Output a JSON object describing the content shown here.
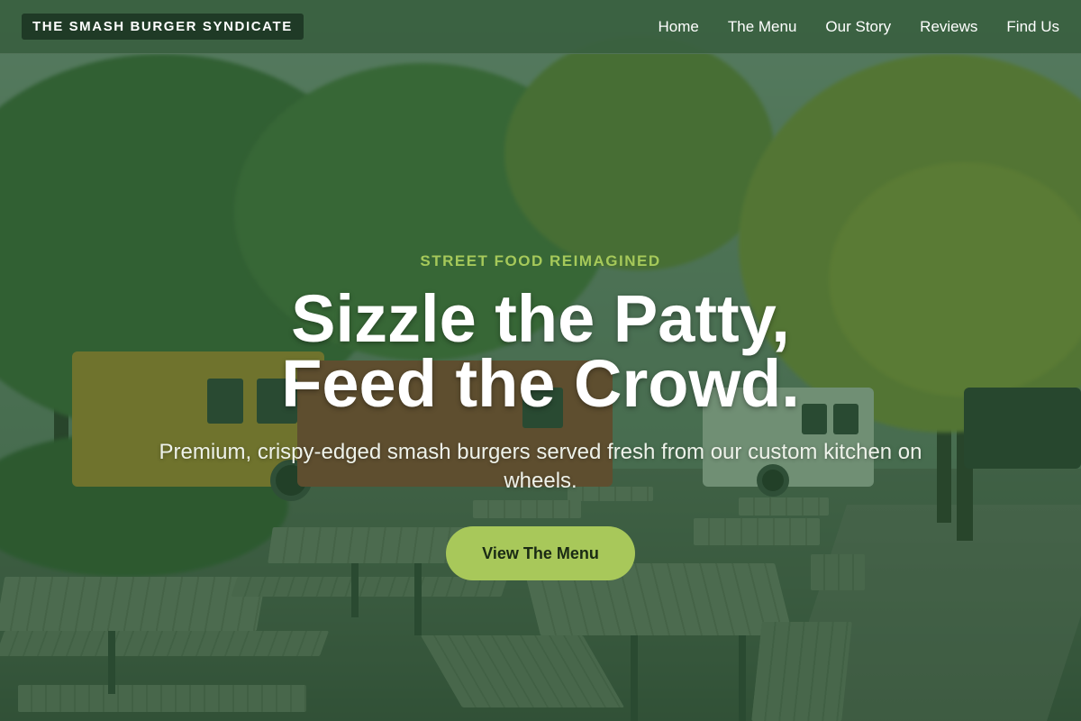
{
  "header": {
    "brand": "THE SMASH BURGER SYNDICATE",
    "nav": [
      {
        "label": "Home"
      },
      {
        "label": "The Menu"
      },
      {
        "label": "Our Story"
      },
      {
        "label": "Reviews"
      },
      {
        "label": "Find Us"
      }
    ]
  },
  "hero": {
    "eyebrow": "STREET FOOD REIMAGINED",
    "headline_line1": "Sizzle the Patty,",
    "headline_line2": "Feed the Crowd.",
    "subtitle": "Premium, crispy-edged smash burgers served fresh from our custom kitchen on wheels.",
    "cta_label": "View The Menu"
  },
  "colors": {
    "accent": "#a8c85a",
    "eyebrow": "#a6c95a",
    "header_bg": "#3a6040",
    "brand_bg": "#1f3a26",
    "overlay": "#265830"
  }
}
